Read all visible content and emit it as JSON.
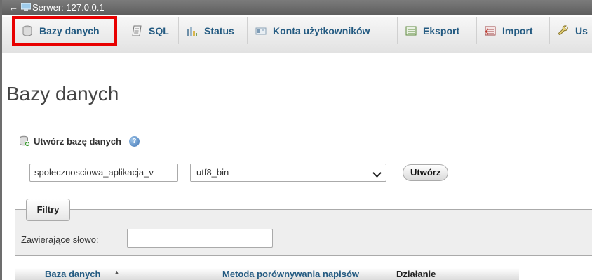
{
  "server": {
    "label": "Serwer: 127.0.0.1",
    "back_symbol": "←"
  },
  "menu": {
    "active_highlight_color": "#e80000",
    "tabs": [
      {
        "label": "Bazy danych",
        "icon": "database-icon",
        "active": true
      },
      {
        "label": "SQL",
        "icon": "sql-sheet-icon"
      },
      {
        "label": "Status",
        "icon": "status-chart-icon"
      },
      {
        "label": "Konta użytkowników",
        "icon": "user-accounts-icon"
      },
      {
        "label": "Eksport",
        "icon": "export-icon"
      },
      {
        "label": "Import",
        "icon": "import-icon"
      },
      {
        "label": "Us",
        "icon": "wrench-icon"
      }
    ]
  },
  "page": {
    "title": "Bazy danych"
  },
  "create_db": {
    "label": "Utwórz bazę danych",
    "help_symbol": "?",
    "name_value": "spolecznosciowa_aplikacja_v",
    "collation_value": "utf8_bin",
    "button_label": "Utwórz"
  },
  "filters": {
    "legend": "Filtry",
    "contains_label": "Zawierające słowo:",
    "contains_value": ""
  },
  "table": {
    "columns": [
      "Baza danych",
      "Metoda porównywania napisów",
      "Działanie"
    ],
    "sort_indicator": "▲"
  }
}
